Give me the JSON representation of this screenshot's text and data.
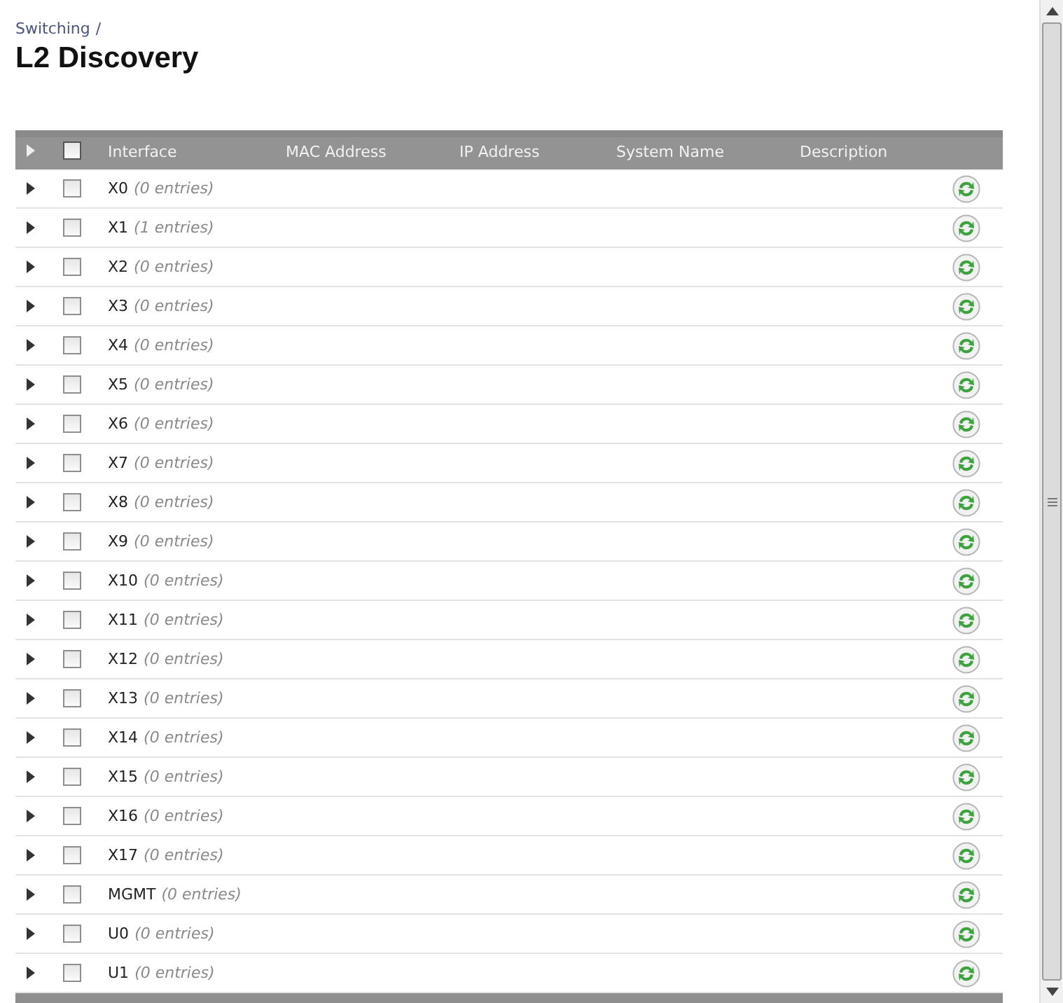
{
  "breadcrumb": {
    "link": "Switching",
    "separator": "/"
  },
  "title": "L2 Discovery",
  "table": {
    "select_all_checked": false,
    "columns": [
      "Interface",
      "MAC Address",
      "IP Address",
      "System Name",
      "Description"
    ],
    "rows": [
      {
        "interface": "X0",
        "entries": "(0 entries)",
        "checked": false,
        "expanded": false
      },
      {
        "interface": "X1",
        "entries": "(1 entries)",
        "checked": false,
        "expanded": false
      },
      {
        "interface": "X2",
        "entries": "(0 entries)",
        "checked": false,
        "expanded": false
      },
      {
        "interface": "X3",
        "entries": "(0 entries)",
        "checked": false,
        "expanded": false
      },
      {
        "interface": "X4",
        "entries": "(0 entries)",
        "checked": false,
        "expanded": false
      },
      {
        "interface": "X5",
        "entries": "(0 entries)",
        "checked": false,
        "expanded": false
      },
      {
        "interface": "X6",
        "entries": "(0 entries)",
        "checked": false,
        "expanded": false
      },
      {
        "interface": "X7",
        "entries": "(0 entries)",
        "checked": false,
        "expanded": false
      },
      {
        "interface": "X8",
        "entries": "(0 entries)",
        "checked": false,
        "expanded": false
      },
      {
        "interface": "X9",
        "entries": "(0 entries)",
        "checked": false,
        "expanded": false
      },
      {
        "interface": "X10",
        "entries": "(0 entries)",
        "checked": false,
        "expanded": false
      },
      {
        "interface": "X11",
        "entries": "(0 entries)",
        "checked": false,
        "expanded": false
      },
      {
        "interface": "X12",
        "entries": "(0 entries)",
        "checked": false,
        "expanded": false
      },
      {
        "interface": "X13",
        "entries": "(0 entries)",
        "checked": false,
        "expanded": false
      },
      {
        "interface": "X14",
        "entries": "(0 entries)",
        "checked": false,
        "expanded": false
      },
      {
        "interface": "X15",
        "entries": "(0 entries)",
        "checked": false,
        "expanded": false
      },
      {
        "interface": "X16",
        "entries": "(0 entries)",
        "checked": false,
        "expanded": false
      },
      {
        "interface": "X17",
        "entries": "(0 entries)",
        "checked": false,
        "expanded": false
      },
      {
        "interface": "MGMT",
        "entries": "(0 entries)",
        "checked": false,
        "expanded": false
      },
      {
        "interface": "U0",
        "entries": "(0 entries)",
        "checked": false,
        "expanded": false
      },
      {
        "interface": "U1",
        "entries": "(0 entries)",
        "checked": false,
        "expanded": false
      }
    ]
  }
}
